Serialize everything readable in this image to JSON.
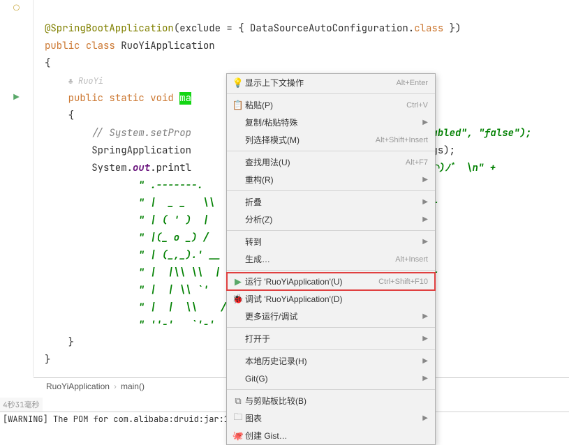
{
  "code": {
    "annotation": "@SpringBootApplication",
    "exclude_lhs": "(exclude = { DataSourceAutoConfiguration.",
    "class_kw": "class",
    "exclude_rhs": " })",
    "public": "public",
    "class_name": "RuoYiApplication",
    "author_label": "♣ RuoYi",
    "static": "static",
    "void": "void",
    "main": "ma",
    "brace_open": "{",
    "brace_close": "}",
    "comment": "// System.setProp",
    "comment_tail": "enabled\", \"false\");",
    "spring_app": "SpringApplication",
    "spring_tail": "gs);",
    "system": "System.",
    "out": "out",
    "println": ".printl",
    "str_tail1": "(♥◠‿◠)ﾉﾞ  \\n\" +",
    "ascii1": "\" .-------.       ",
    "ascii1b": "\" +",
    "ascii2": "\" |  _ _   \\\\      ",
    "ascii3": "\" | ( ' )  |       ",
    "ascii4": "\" |(_ o _) /      ",
    "ascii5": "\" | (_,_).' __   ",
    "ascii6": "\" |  |\\\\ \\\\  |  |  ",
    "ascii7": "\" |  | \\\\ `'   /  ",
    "ascii8": "\" |  |  \\\\    /   ",
    "ascii9": "\" ''-'   `'-'    ",
    "plus": "\" +"
  },
  "breadcrumb": {
    "l1": "RuoYiApplication",
    "l2": "main()"
  },
  "console": {
    "time": "4秒31毫秒",
    "msg": "[WARNING] The POM for com.alibaba:druid:jar:1.2.11 is invalid, transitive d"
  },
  "menu": {
    "show_context": "显示上下文操作",
    "show_context_sc": "Alt+Enter",
    "paste": "粘贴(P)",
    "paste_sc": "Ctrl+V",
    "paste_special": "复制/粘贴特殊",
    "column_mode": "列选择模式(M)",
    "column_mode_sc": "Alt+Shift+Insert",
    "find_usage": "查找用法(U)",
    "find_usage_sc": "Alt+F7",
    "refactor": "重构(R)",
    "fold": "折叠",
    "analyze": "分析(Z)",
    "goto": "转到",
    "generate": "生成…",
    "generate_sc": "Alt+Insert",
    "run": "运行 'RuoYiApplication'(U)",
    "run_sc": "Ctrl+Shift+F10",
    "debug": "调试 'RuoYiApplication'(D)",
    "more_run": "更多运行/调试",
    "open_in": "打开于",
    "local_history": "本地历史记录(H)",
    "git": "Git(G)",
    "compare_clipboard": "与剪贴板比较(B)",
    "diagram": "图表",
    "create_gist": "创建 Gist…"
  }
}
